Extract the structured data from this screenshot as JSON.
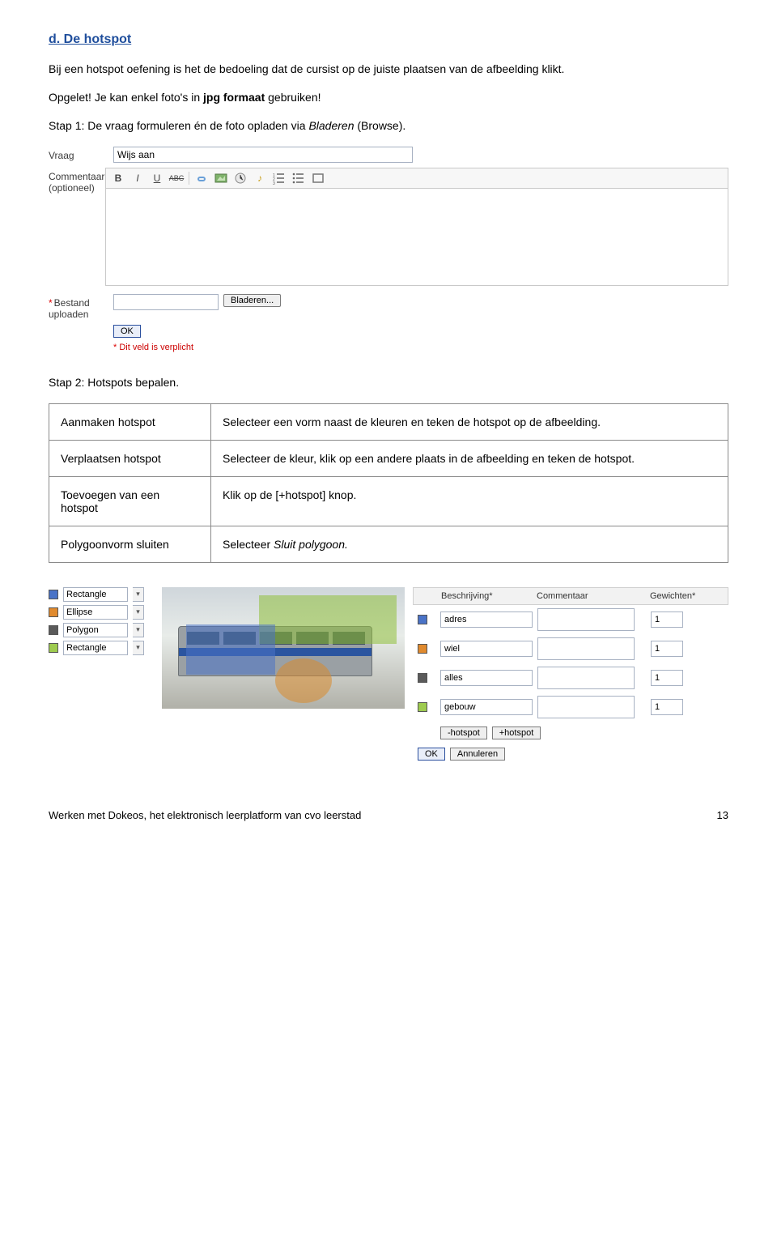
{
  "section_title": "d. De hotspot",
  "intro_1": "Bij een hotspot oefening is het de bedoeling dat de cursist op de juiste plaatsen van de afbeelding klikt.",
  "intro_2a": "Opgelet! Je kan enkel foto's in ",
  "intro_2b": "jpg formaat",
  "intro_2c": " gebruiken!",
  "stap1_a": "Stap 1: De vraag formuleren én de foto opladen via ",
  "stap1_b": "Bladeren",
  "stap1_c": " (Browse).",
  "form1": {
    "vraag_label": "Vraag",
    "vraag_value": "Wijs aan",
    "commentaar_label": "Commentaar (optioneel)",
    "bestand_label": "Bestand uploaden",
    "browse": "Bladeren...",
    "ok": "OK",
    "req": " Dit veld is verplicht"
  },
  "stap2": "Stap 2: Hotspots bepalen.",
  "table": {
    "r1a": "Aanmaken hotspot",
    "r1b": "Selecteer een vorm naast de kleuren en teken de hotspot op de afbeelding.",
    "r2a": "Verplaatsen hotspot",
    "r2b": "Selecteer de kleur, klik op een andere plaats in de afbeelding en teken de hotspot.",
    "r3a": "Toevoegen van een hotspot",
    "r3b": "Klik op de [+hotspot] knop.",
    "r4a": "Polygoonvorm sluiten",
    "r4b_a": "Selecteer ",
    "r4b_b": "Sluit polygoon."
  },
  "shapes": {
    "blue": {
      "color": "#4a73c7",
      "label": "Rectangle"
    },
    "orange": {
      "color": "#e08a2e",
      "label": "Ellipse"
    },
    "grey": {
      "color": "#5a5a5a",
      "label": "Polygon"
    },
    "green": {
      "color": "#9ecb4f",
      "label": "Rectangle"
    }
  },
  "rt": {
    "h1": "Beschrijving*",
    "h2": "Commentaar",
    "h3": "Gewichten*",
    "rows": [
      {
        "color": "#4a73c7",
        "desc": "adres",
        "w": "1"
      },
      {
        "color": "#e08a2e",
        "desc": "wiel",
        "w": "1"
      },
      {
        "color": "#5a5a5a",
        "desc": "alles",
        "w": "1"
      },
      {
        "color": "#9ecb4f",
        "desc": "gebouw",
        "w": "1"
      }
    ],
    "minus": "-hotspot",
    "plus": "+hotspot",
    "ok": "OK",
    "cancel": "Annuleren"
  },
  "footer_left": "Werken met Dokeos, het elektronisch leerplatform van cvo leerstad",
  "footer_right": "13"
}
